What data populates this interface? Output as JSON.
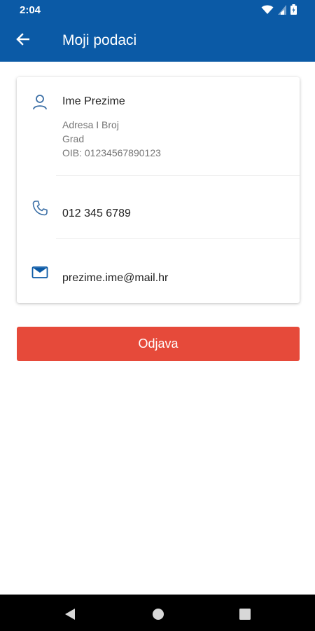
{
  "status_bar": {
    "time": "2:04",
    "icons": [
      "wifi-icon",
      "signal-icon",
      "battery-icon"
    ]
  },
  "app_bar": {
    "title": "Moji podaci",
    "back_icon": "arrow-back-icon"
  },
  "profile_card": {
    "person": {
      "icon": "person-icon",
      "name": "Ime Prezime",
      "address": "Adresa I Broj",
      "city": "Grad",
      "oib": "OIB: 01234567890123"
    },
    "phone": {
      "icon": "phone-icon",
      "value": "012 345 6789"
    },
    "email": {
      "icon": "mail-icon",
      "value": "prezime.ime@mail.hr"
    }
  },
  "logout_button": {
    "label": "Odjava"
  },
  "navigation_bar": {
    "buttons": [
      "back-triangle-icon",
      "home-circle-icon",
      "recents-square-icon"
    ]
  },
  "colors": {
    "primary": "#0b5aa6",
    "logout": "#e64a3a",
    "icon_blue": "#3a6ea5"
  }
}
